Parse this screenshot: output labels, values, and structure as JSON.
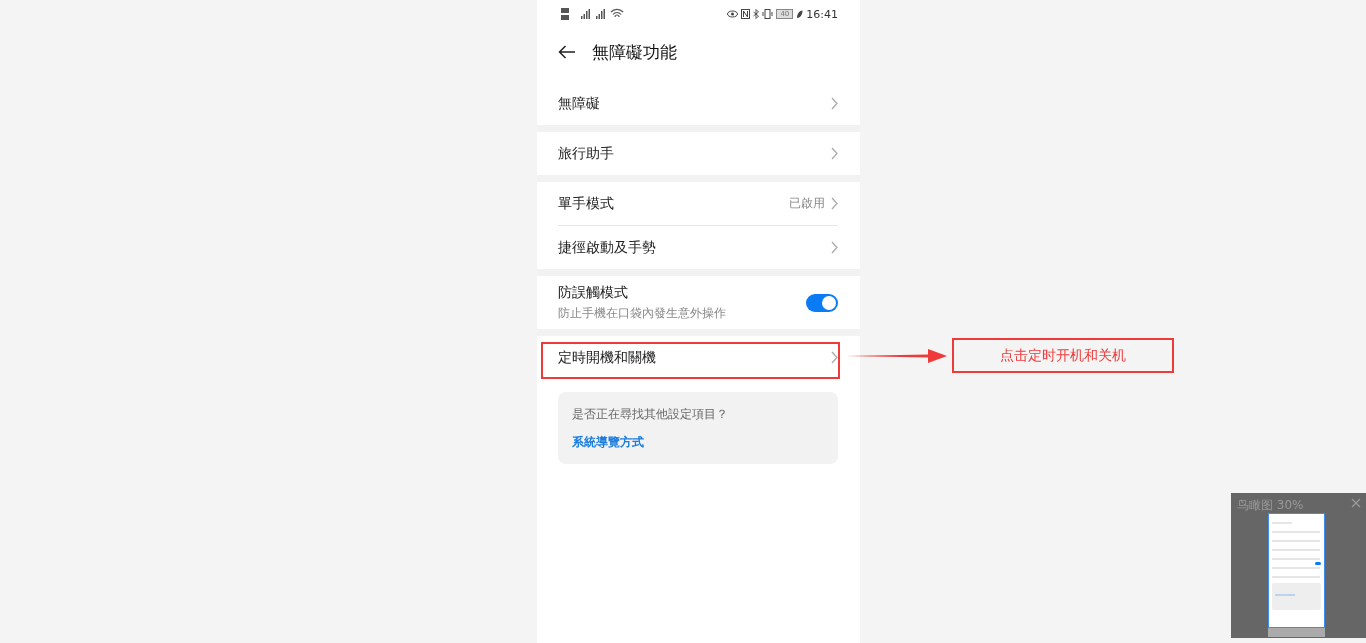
{
  "status_bar": {
    "time": "16:41",
    "battery": "40"
  },
  "header": {
    "title": "無障礙功能"
  },
  "groups": [
    {
      "items": [
        {
          "kind": "link",
          "label": "無障礙"
        }
      ]
    },
    {
      "items": [
        {
          "kind": "link",
          "label": "旅行助手"
        }
      ]
    },
    {
      "items": [
        {
          "kind": "link",
          "label": "單手模式",
          "value": "已啟用"
        },
        {
          "kind": "link",
          "label": "捷徑啟動及手勢"
        }
      ]
    },
    {
      "items": [
        {
          "kind": "toggle",
          "label": "防誤觸模式",
          "description": "防止手機在口袋內發生意外操作",
          "on": true
        }
      ]
    },
    {
      "items": [
        {
          "kind": "link",
          "label": "定時開機和關機",
          "highlighted": true
        }
      ]
    }
  ],
  "suggestion": {
    "question": "是否正在尋找其他設定項目？",
    "link": "系統導覽方式"
  },
  "annotation": {
    "text": "点击定时开机和关机"
  },
  "navigator": {
    "title": "鸟瞰图 30%"
  }
}
